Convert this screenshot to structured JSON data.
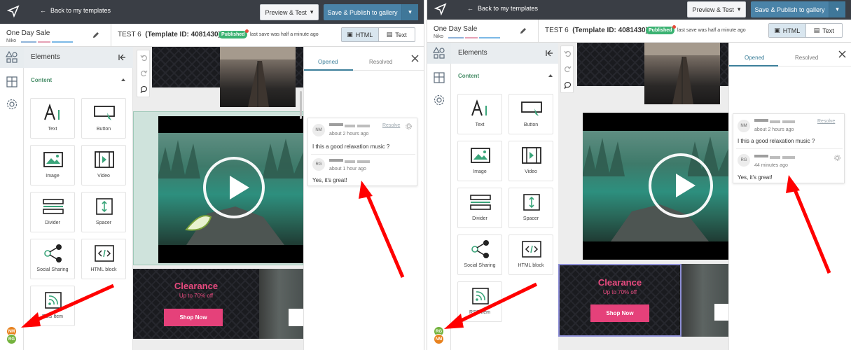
{
  "colors": {
    "topbar": "#3a3e45",
    "publish": "#4a83a8",
    "accent_green": "#3bb272",
    "tab_active": "#3c7f9a",
    "arrow": "#ff0000",
    "shop_button": "#e5417a"
  },
  "topbar": {
    "back_label": "Back to my templates",
    "preview_label": "Preview & Test",
    "publish_label": "Save & Publish to gallery",
    "nav_icon": "paper-plane-icon"
  },
  "template": {
    "name": "One Day Sale",
    "owner": "Niko",
    "title_prefix": "TEST 6",
    "title_id": "(Template ID: 4081430)",
    "status_badge": "Published",
    "save_status": "last save was half a minute ago"
  },
  "view_toggle": {
    "html_label": "HTML",
    "text_label": "Text",
    "active": "HTML"
  },
  "elements_panel": {
    "title": "Elements",
    "section": "Content",
    "items": [
      {
        "label": "Text",
        "icon": "text-icon"
      },
      {
        "label": "Button",
        "icon": "button-icon"
      },
      {
        "label": "Image",
        "icon": "image-icon"
      },
      {
        "label": "Video",
        "icon": "video-icon"
      },
      {
        "label": "Divider",
        "icon": "divider-icon"
      },
      {
        "label": "Spacer",
        "icon": "spacer-icon"
      },
      {
        "label": "Social Sharing",
        "icon": "share-icon"
      },
      {
        "label": "HTML block",
        "icon": "code-icon"
      },
      {
        "label": "RSS Item",
        "icon": "rss-icon"
      }
    ]
  },
  "rail": {
    "avatars": [
      "NM",
      "RG"
    ]
  },
  "canvas": {
    "banner": {
      "title": "Clearance",
      "subtitle": "Up to 70% off",
      "button": "Shop Now"
    }
  },
  "comments_panel": {
    "tabs": [
      "Opened",
      "Resolved"
    ],
    "active_tab": "Opened",
    "resolve_label": "Resolve",
    "screen1": [
      {
        "initials": "NM",
        "time": "about 2 hours ago",
        "text": "I this a good relaxation music ?"
      },
      {
        "initials": "RG",
        "time": "about 1 hour ago",
        "text": "Yes, it's great!"
      }
    ],
    "screen2": [
      {
        "initials": "NM",
        "time": "about 2 hours ago",
        "text": "I this a good relaxation music ?"
      },
      {
        "initials": "RG",
        "time": "44 minutes ago",
        "text": "Yes, it's great!"
      }
    ]
  }
}
